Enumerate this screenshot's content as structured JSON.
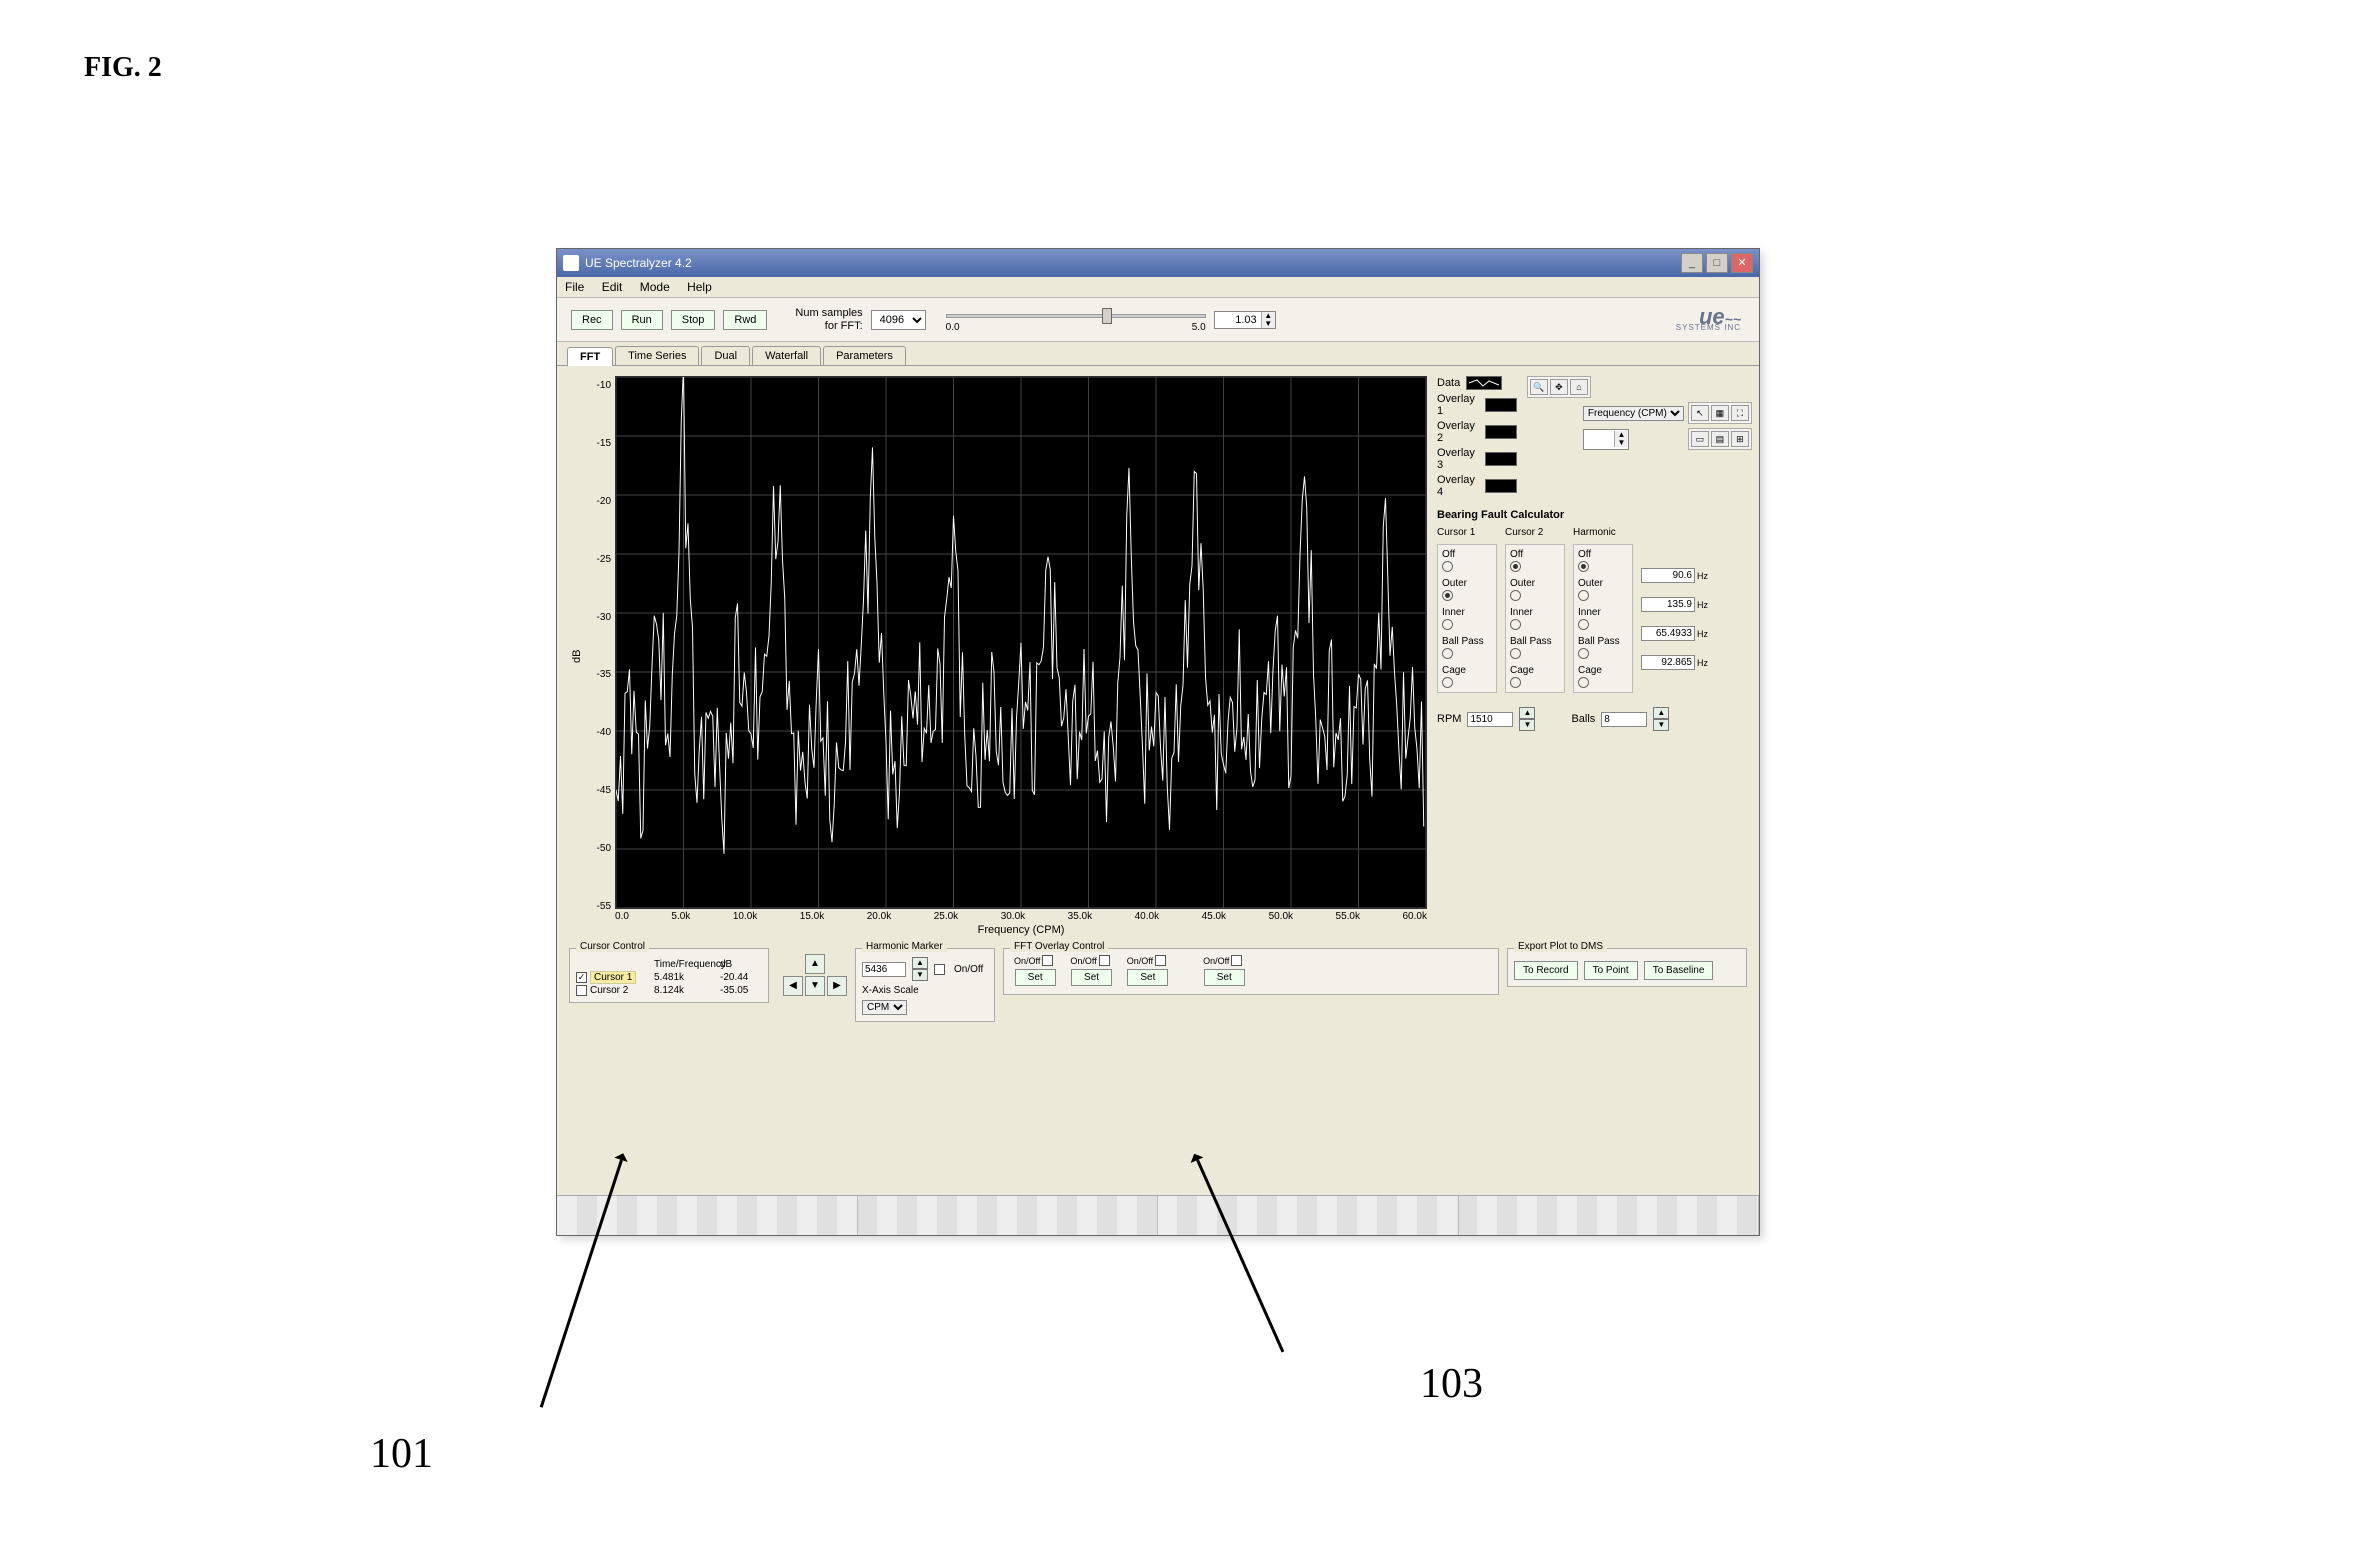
{
  "figure_label": "FIG. 2",
  "annotations": {
    "a": "101",
    "b": "103"
  },
  "window": {
    "title": "UE Spectralyzer 4.2",
    "minimize": "_",
    "maximize": "□",
    "close": "✕"
  },
  "menu": {
    "file": "File",
    "edit": "Edit",
    "mode": "Mode",
    "help": "Help"
  },
  "toolbar": {
    "rec": "Rec",
    "run": "Run",
    "stop": "Stop",
    "rwd": "Rwd",
    "num_samples_label": "Num samples\nfor FFT:",
    "num_samples_value": "4096",
    "slider_min": "0.0",
    "slider_max": "5.0",
    "gain_value": "1.03",
    "brand": "ue",
    "brand_sub": "SYSTEMS INC"
  },
  "tabs": {
    "fft": "FFT",
    "time": "Time Series",
    "dual": "Dual",
    "waterfall": "Waterfall",
    "params": "Parameters"
  },
  "chart_data": {
    "type": "line",
    "title": "",
    "xlabel": "Frequency (CPM)",
    "ylabel": "dB",
    "yticks": [
      "-10",
      "-15",
      "-20",
      "-25",
      "-30",
      "-35",
      "-40",
      "-45",
      "-50",
      "-55"
    ],
    "xticks": [
      "0.0",
      "5.0k",
      "10.0k",
      "15.0k",
      "20.0k",
      "25.0k",
      "30.0k",
      "35.0k",
      "40.0k",
      "45.0k",
      "50.0k",
      "55.0k",
      "60.0k"
    ],
    "ylim": [
      -55,
      -10
    ],
    "xlim": [
      0,
      60000
    ],
    "series": [
      {
        "name": "Data",
        "x": [
          0,
          1000,
          2000,
          3000,
          4000,
          5000,
          6000,
          7000,
          8000,
          9000,
          10000,
          11000,
          12000,
          13000,
          14000,
          15000,
          16000,
          17000,
          18000,
          19000,
          20000,
          21000,
          22000,
          23000,
          24000,
          25000,
          26000,
          27000,
          28000,
          29000,
          30000,
          31000,
          32000,
          33000,
          34000,
          35000,
          36000,
          37000,
          38000,
          39000,
          40000,
          41000,
          42000,
          43000,
          44000,
          45000,
          46000,
          47000,
          48000,
          49000,
          50000,
          51000,
          52000,
          53000,
          54000,
          55000,
          56000,
          57000,
          58000,
          59000,
          60000
        ],
        "y": [
          -48,
          -36,
          -45,
          -30,
          -42,
          -14,
          -44,
          -38,
          -46,
          -34,
          -40,
          -36,
          -18,
          -42,
          -44,
          -38,
          -46,
          -40,
          -34,
          -20,
          -42,
          -44,
          -36,
          -40,
          -38,
          -22,
          -44,
          -42,
          -38,
          -46,
          -36,
          -40,
          -26,
          -38,
          -42,
          -36,
          -44,
          -40,
          -22,
          -42,
          -38,
          -44,
          -36,
          -20,
          -40,
          -42,
          -36,
          -44,
          -38,
          -34,
          -40,
          -18,
          -42,
          -38,
          -44,
          -36,
          -40,
          -24,
          -42,
          -38,
          -46
        ]
      }
    ]
  },
  "legend": {
    "data": "Data",
    "ov1": "Overlay 1",
    "ov2": "Overlay 2",
    "ov3": "Overlay 3",
    "ov4": "Overlay 4",
    "freq_unit": "Frequency (CPM)"
  },
  "bfc": {
    "title": "Bearing Fault Calculator",
    "cols": {
      "c1": "Cursor 1",
      "c2": "Cursor 2",
      "c3": "Harmonic"
    },
    "opts": {
      "off": "Off",
      "outer": "Outer",
      "inner": "Inner",
      "ballpass": "Ball Pass",
      "cage": "Cage"
    },
    "outer_hz": "90.6",
    "inner_hz": "135.9",
    "ballpass_hz": "65.4933",
    "cage_hz": "92.865",
    "hz": "Hz",
    "rpm_label": "RPM",
    "rpm_value": "1510",
    "balls_label": "Balls",
    "balls_value": "8"
  },
  "cursor_control": {
    "title": "Cursor Control",
    "tf": "Time/Frequency",
    "db": "dB",
    "c1": "Cursor 1",
    "c1_tf": "5.481k",
    "c1_db": "-20.44",
    "c2": "Cursor 2",
    "c2_tf": "8.124k",
    "c2_db": "-35.05"
  },
  "harmonic_marker": {
    "title": "Harmonic Marker",
    "value": "5436",
    "onoff": "On/Off",
    "xscale_label": "X-Axis Scale",
    "xscale_value": "CPM"
  },
  "overlay_control": {
    "title": "FFT Overlay Control",
    "onoff": "On/Off",
    "set": "Set"
  },
  "export": {
    "title": "Export Plot to DMS",
    "to_record": "To Record",
    "to_point": "To Point",
    "to_baseline": "To Baseline"
  }
}
